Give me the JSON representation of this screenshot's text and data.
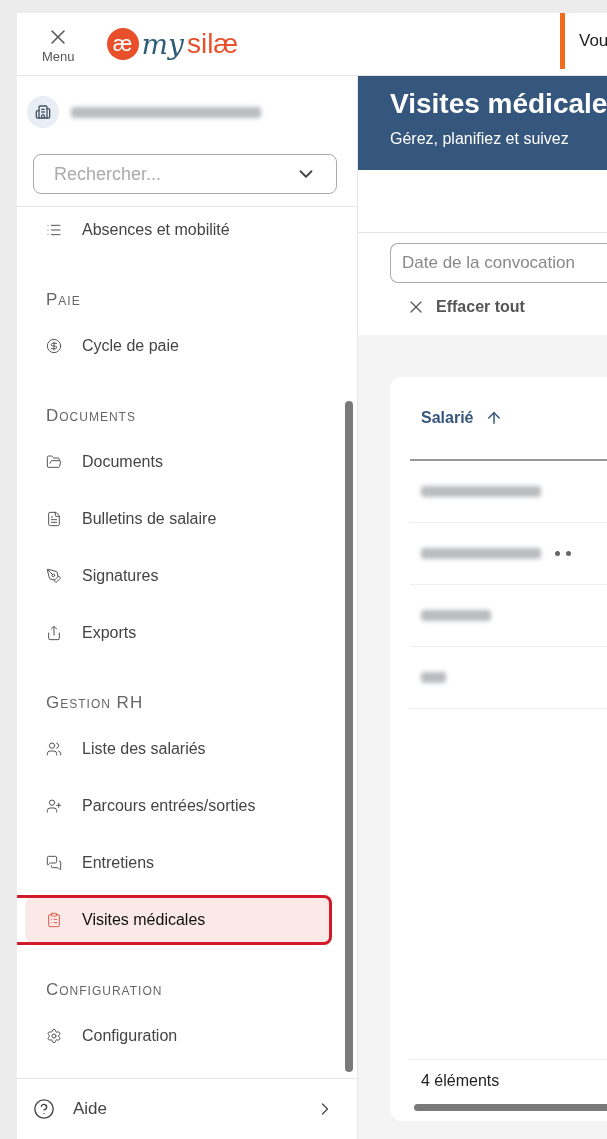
{
  "header": {
    "menu_label": "Menu",
    "logo": {
      "mark": "æ",
      "my": "my",
      "name": "silæ"
    },
    "notice": "Vou"
  },
  "sidebar": {
    "search": {
      "placeholder": "Rechercher..."
    },
    "sections": [
      {
        "items": [
          {
            "label": "Absences et mobilité",
            "kind": "list",
            "selected": false,
            "highlighted": false
          }
        ]
      },
      {
        "title": "Paie",
        "items": [
          {
            "label": "Cycle de paie",
            "kind": "cycle",
            "selected": false,
            "highlighted": false
          }
        ]
      },
      {
        "title": "Documents",
        "items": [
          {
            "label": "Documents",
            "kind": "folder",
            "selected": false,
            "highlighted": false
          },
          {
            "label": "Bulletins de salaire",
            "kind": "payslip",
            "selected": false,
            "highlighted": false
          },
          {
            "label": "Signatures",
            "kind": "pen",
            "selected": false,
            "highlighted": false
          },
          {
            "label": "Exports",
            "kind": "export",
            "selected": false,
            "highlighted": false
          }
        ]
      },
      {
        "title": "Gestion RH",
        "items": [
          {
            "label": "Liste des salariés",
            "kind": "users",
            "selected": false,
            "highlighted": false
          },
          {
            "label": "Parcours entrées/sorties",
            "kind": "user-plus",
            "selected": false,
            "highlighted": false
          },
          {
            "label": "Entretiens",
            "kind": "chat",
            "selected": false,
            "highlighted": false
          },
          {
            "label": "Visites médicales",
            "kind": "clipboard",
            "selected": true,
            "highlighted": true
          }
        ]
      },
      {
        "title": "Configuration",
        "items": [
          {
            "label": "Configuration",
            "kind": "gear",
            "selected": false,
            "highlighted": false
          }
        ]
      }
    ],
    "footer": {
      "label": "Aide"
    }
  },
  "page": {
    "title": "Visites médicale",
    "subtitle": "Gérez, planifiez et suivez",
    "filter": {
      "placeholder": "Date de la convocation"
    },
    "clear": "Effacer tout",
    "table": {
      "columns": [
        {
          "label": "Salarié",
          "sorted_ascending": true
        }
      ],
      "rows": [
        {
          "actions": false
        },
        {
          "actions": true
        },
        {
          "actions": false
        },
        {
          "actions": false
        }
      ],
      "footer": "4 éléments"
    }
  }
}
